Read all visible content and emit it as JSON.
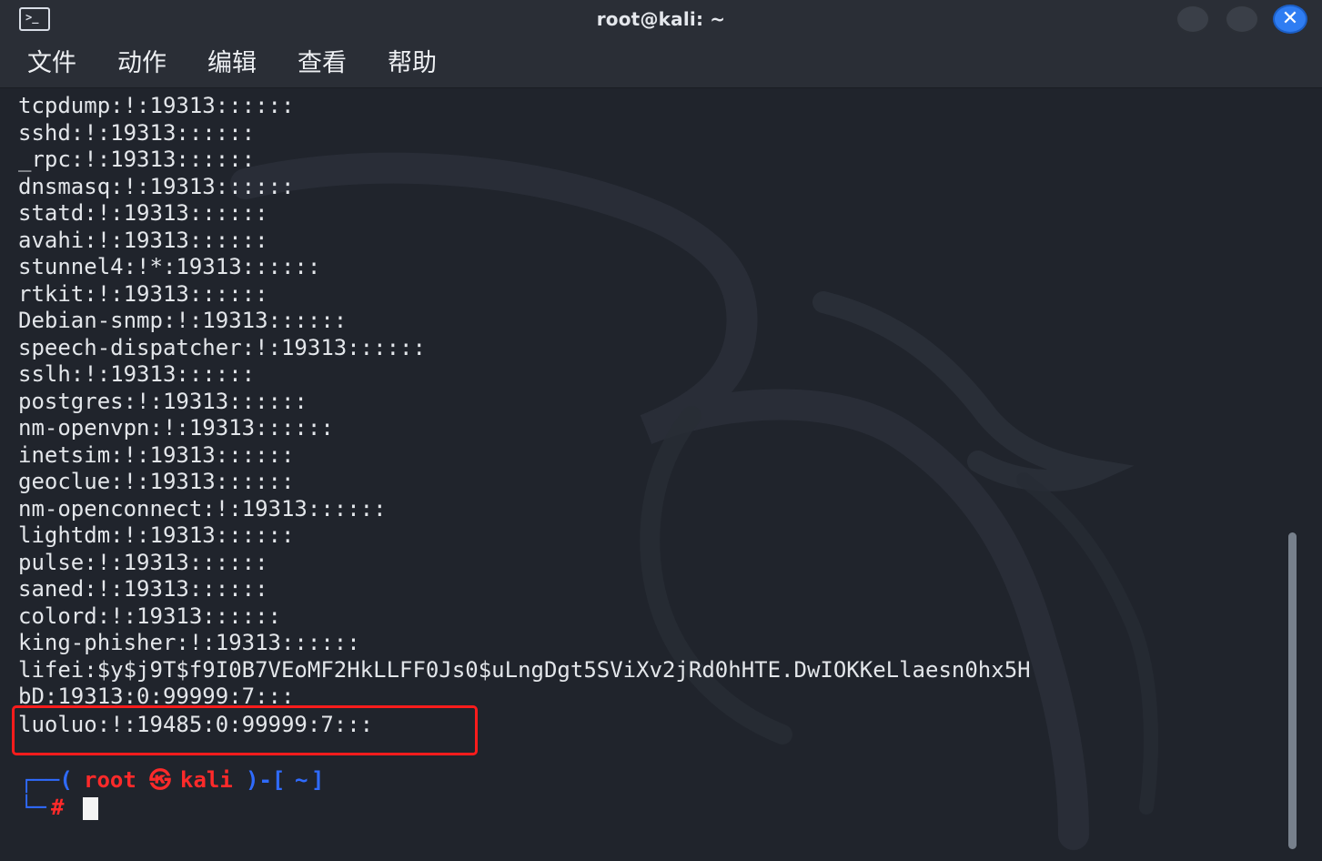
{
  "window": {
    "title": "root@kali: ~",
    "app_icon_glyph": ">_"
  },
  "menu": {
    "items": [
      "文件",
      "动作",
      "编辑",
      "查看",
      "帮助"
    ]
  },
  "terminal": {
    "lines": [
      "tcpdump:!:19313::::::",
      "sshd:!:19313::::::",
      "_rpc:!:19313::::::",
      "dnsmasq:!:19313::::::",
      "statd:!:19313::::::",
      "avahi:!:19313::::::",
      "stunnel4:!*:19313::::::",
      "rtkit:!:19313::::::",
      "Debian-snmp:!:19313::::::",
      "speech-dispatcher:!:19313::::::",
      "sslh:!:19313::::::",
      "postgres:!:19313::::::",
      "nm-openvpn:!:19313::::::",
      "inetsim:!:19313::::::",
      "geoclue:!:19313::::::",
      "nm-openconnect:!:19313::::::",
      "lightdm:!:19313::::::",
      "pulse:!:19313::::::",
      "saned:!:19313::::::",
      "colord:!:19313::::::",
      "king-phisher:!:19313::::::",
      "lifei:$y$j9T$f9I0B7VEoMF2HkLLFF0Js0$uLngDgt5SViXv2jRd0hHTE.DwIOKKeLlaesn0hx5H",
      "bD:19313:0:99999:7:::",
      "luoluo:!:19485:0:99999:7:::"
    ],
    "prompt": {
      "top_left": "┌──(",
      "user": "root",
      "at_symbol": "㉿",
      "host": "kali",
      "close_and_path_open": ")-[",
      "path": "~",
      "path_close": "]",
      "bottom_left": "└─",
      "hash": "#"
    }
  },
  "colors": {
    "background": "#20242c",
    "titlebar": "#2a2e36",
    "text": "#e3e6ea",
    "prompt_blue": "#2f6bff",
    "prompt_red": "#ff2a2a",
    "highlight_border": "#ff1c1c",
    "close_button": "#2f7df2"
  },
  "icons": {
    "app_icon": "terminal-icon",
    "minimize": "minimize-icon",
    "maximize": "maximize-icon",
    "close": "close-icon",
    "background": "kali-dragon-logo"
  }
}
